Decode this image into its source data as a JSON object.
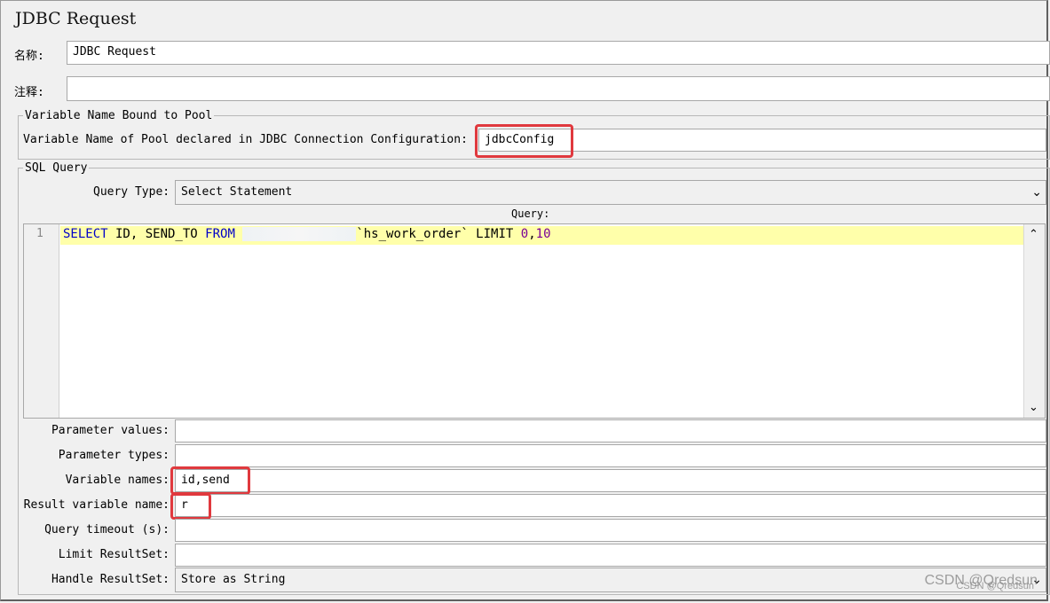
{
  "window": {
    "title": "JDBC Request"
  },
  "name_field": {
    "label": "名称:",
    "value": "JDBC Request"
  },
  "comment_field": {
    "label": "注释:",
    "value": ""
  },
  "pool_group": {
    "legend": "Variable Name Bound to Pool",
    "label": "Variable Name of Pool declared in JDBC Connection Configuration:",
    "value": "jdbcConfig"
  },
  "sql_group": {
    "legend": "SQL Query",
    "query_type_label": "Query Type:",
    "query_type_value": "Select Statement",
    "query_label": "Query:",
    "line_number": "1",
    "sql": {
      "kw_select": "SELECT",
      "cols": " ID, SEND_TO ",
      "kw_from": "FROM",
      "table": "`hs_work_order`",
      "limit": " LIMIT ",
      "n0": "0",
      "comma": ",",
      "n10": "10"
    }
  },
  "params": [
    {
      "label": "Parameter values:",
      "value": ""
    },
    {
      "label": "Parameter types:",
      "value": ""
    },
    {
      "label": "Variable names:",
      "value": "id,send"
    },
    {
      "label": "Result variable name:",
      "value": "r"
    },
    {
      "label": "Query timeout (s):",
      "value": ""
    },
    {
      "label": "Limit ResultSet:",
      "value": ""
    }
  ],
  "handle_resultset": {
    "label": "Handle ResultSet:",
    "value": "Store as String"
  },
  "watermark": {
    "text": "CSDN @Qredsun",
    "text_small": "CSDN @Qredsun"
  },
  "colors": {
    "highlight": "#e0393e",
    "keyword": "#0000c8",
    "number": "#7a0096",
    "current_line": "#ffffaa"
  },
  "icons": {
    "dropdown": "chevron-down-icon",
    "scroll_up": "chevron-up-icon",
    "scroll_down": "chevron-down-icon"
  }
}
